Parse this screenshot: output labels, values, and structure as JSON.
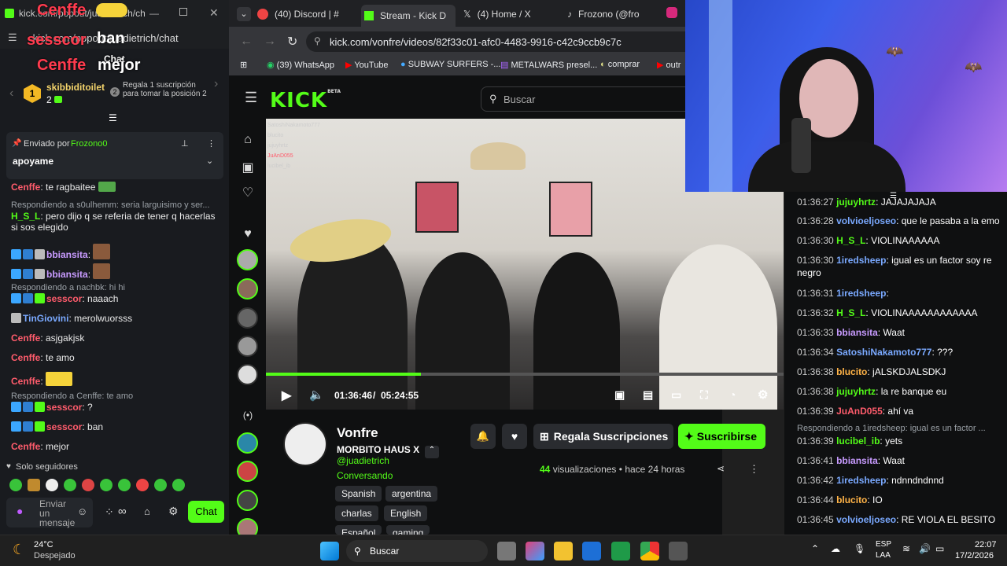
{
  "left_window": {
    "title": "kick.com/popout/juadietrich/chat",
    "address": "kick.com/popout/juadietrich/chat",
    "overlay_texts": [
      "Cenffe",
      "sesscor",
      "ban",
      "Chat",
      "Cenffe",
      "mejor"
    ],
    "goal_user": "skibbiditoilet",
    "goal_count": "2",
    "goal_rank": "1",
    "goal_text": "Regala 1 suscripción para tomar la posición 2",
    "goal_rank2": "2",
    "pinned_by_prefix": "Enviado por",
    "pinned_by_user": "Frozono0",
    "pinned_message": "apoyame",
    "chat": [
      {
        "user": "Cenffe",
        "text": ": te ragbaitee",
        "color": "#ff5c6c"
      },
      {
        "reply": "Respondiendo a s0ulhemm: seria larguisimo y ser..."
      },
      {
        "user": "H_S_L",
        "text": ": pero dijo q se referia de tener q hacerlas si sos elegido",
        "color": "#53fc18"
      },
      {
        "user": "bbiansita",
        "text": ":",
        "color": "#c89bff"
      },
      {
        "user": "bbiansita",
        "text": ":",
        "color": "#c89bff"
      },
      {
        "reply": "Respondiendo a nachbk: hi hi"
      },
      {
        "user": "sesscor",
        "text": ": naaach",
        "color": "#ff5c6c"
      },
      {
        "user": "TinGiovini",
        "text": ": merolwuorsss",
        "color": "#7aa9ff"
      },
      {
        "user": "Cenffe",
        "text": ": asjgakjsk",
        "color": "#ff5c6c"
      },
      {
        "user": "Cenffe",
        "text": ": te amo",
        "color": "#ff5c6c"
      },
      {
        "user": "Cenffe",
        "text": ":",
        "color": "#ff5c6c"
      },
      {
        "reply": "Respondiendo a Cenffe: te amo"
      },
      {
        "user": "sesscor",
        "text": ": ?",
        "color": "#ff5c6c"
      },
      {
        "user": "sesscor",
        "text": ": ban",
        "color": "#ff5c6c"
      },
      {
        "user": "Cenffe",
        "text": ": mejor",
        "color": "#ff5c6c"
      }
    ],
    "followers_only": "Solo seguidores",
    "input_placeholder": "Enviar un mensaje",
    "chat_button": "Chat"
  },
  "browser": {
    "tabs": [
      {
        "label": "(40) Discord | #"
      },
      {
        "label": "Stream - Kick D"
      },
      {
        "label": "(4) Home / X"
      },
      {
        "label": "Frozono (@fro"
      }
    ],
    "url": "kick.com/vonfre/videos/82f33c01-afc0-4483-9916-c42c9ccb9c7c",
    "bookmarks": [
      "(39) WhatsApp",
      "YouTube",
      "SUBWAY SURFERS -...",
      "METALWARS presel...",
      "comprar",
      "outr"
    ],
    "logo": "KICK",
    "logo_beta": "BETA",
    "search_placeholder": "Buscar",
    "video_overlay_chat": [
      "SatoshiNakamoto777",
      "blucito",
      "jujuyhrtz",
      "JuAnD055",
      "lucibel_ib"
    ],
    "time_current": "01:36:46",
    "time_sep": "/",
    "time_total": "05:24:55",
    "progress_fraction": 0.3,
    "streamer": "Vonfre",
    "stream_title": "MORBITO HAUS X",
    "stream_handle": "@juadietrich",
    "category": "Conversando",
    "gift_button": "Regala Suscripciones",
    "subscribe_button": "Suscribirse",
    "views": "44",
    "views_label": "visualizaciones",
    "time_ago": "hace 24 horas",
    "tags": [
      "Spanish",
      "argentina",
      "charlas",
      "English",
      "Español",
      "gaming"
    ]
  },
  "right_chat": [
    {
      "ts": "01:36:27",
      "user": "jujuyhrtz",
      "text": ": JAJAJAJAJA",
      "color": "#53fc18"
    },
    {
      "ts": "01:36:28",
      "user": "volvioeljoseo",
      "text": ": que le pasaba a la emo",
      "color": "#7aa9ff"
    },
    {
      "ts": "01:36:30",
      "user": "H_S_L",
      "text": ": VIOLINAAAAAA",
      "color": "#53fc18"
    },
    {
      "ts": "01:36:30",
      "user": "1iredsheep",
      "text": ": igual es un factor soy re negro",
      "color": "#7aa9ff"
    },
    {
      "ts": "01:36:31",
      "user": "1iredsheep",
      "text": ":",
      "color": "#7aa9ff"
    },
    {
      "ts": "01:36:32",
      "user": "H_S_L",
      "text": ": VIOLINAAAAAAAAAAAA",
      "color": "#53fc18"
    },
    {
      "ts": "01:36:33",
      "user": "bbiansita",
      "text": ": Waat",
      "color": "#c89bff"
    },
    {
      "ts": "01:36:34",
      "user": "SatoshiNakamoto777",
      "text": ": ???",
      "color": "#7aa9ff"
    },
    {
      "ts": "01:36:38",
      "user": "blucito",
      "text": ": jALSKDJALSDKJ",
      "color": "#ffb347"
    },
    {
      "ts": "01:36:38",
      "user": "jujuyhrtz",
      "text": ": la re banque eu",
      "color": "#53fc18"
    },
    {
      "ts": "01:36:39",
      "user": "JuAnD055",
      "text": ": ahí va",
      "color": "#ff5c6c"
    },
    {
      "reply": "Respondiendo a 1iredsheep: igual es un factor ..."
    },
    {
      "ts": "01:36:39",
      "user": "lucibel_ib",
      "text": ": yets",
      "color": "#53fc18"
    },
    {
      "ts": "01:36:41",
      "user": "bbiansita",
      "text": ": Waat",
      "color": "#c89bff"
    },
    {
      "ts": "01:36:42",
      "user": "1iredsheep",
      "text": ": ndnndndnnd",
      "color": "#7aa9ff"
    },
    {
      "ts": "01:36:44",
      "user": "blucito",
      "text": ": IO",
      "color": "#ffb347"
    },
    {
      "ts": "01:36:45",
      "user": "volvioeljoseo",
      "text": ": RE VIOLA EL BESITO",
      "color": "#7aa9ff"
    }
  ],
  "taskbar": {
    "weather_temp": "24°C",
    "weather_desc": "Despejado",
    "search": "Buscar",
    "lang1": "ESP",
    "lang2": "LAA",
    "time": "22:07",
    "date": "17/2/2026"
  },
  "colors": {
    "kick_green": "#53fc18",
    "bg": "#0f1011"
  }
}
